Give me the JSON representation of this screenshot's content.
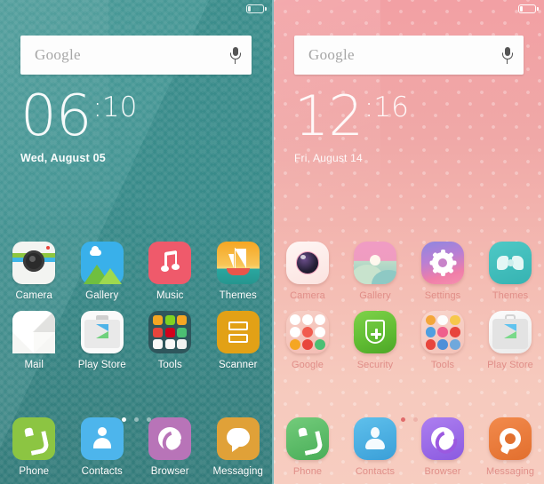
{
  "screens": [
    {
      "id": "teal-home",
      "theme_name": "teal-wave-theme",
      "accent": "#3d9290",
      "label_color": "#ffffff",
      "statusbar": {
        "battery_icon": "battery-icon"
      },
      "search": {
        "placeholder": "Google",
        "mic_icon": "microphone-icon"
      },
      "clock": {
        "hours": "06",
        "minutes": ":10",
        "date": "Wed, August 05"
      },
      "grid": [
        [
          {
            "label": "Camera",
            "icon": "camera-icon"
          },
          {
            "label": "Gallery",
            "icon": "gallery-icon"
          },
          {
            "label": "Music",
            "icon": "music-icon"
          },
          {
            "label": "Themes",
            "icon": "themes-sailboat-icon"
          }
        ],
        [
          {
            "label": "Mail",
            "icon": "mail-envelope-icon"
          },
          {
            "label": "Play Store",
            "icon": "play-store-icon"
          },
          {
            "label": "Tools",
            "icon": "tools-folder-icon"
          },
          {
            "label": "Scanner",
            "icon": "scanner-icon"
          }
        ]
      ],
      "page_dots": {
        "count": 3,
        "active": 0
      },
      "dock": [
        {
          "label": "Phone",
          "icon": "phone-icon"
        },
        {
          "label": "Contacts",
          "icon": "contacts-icon"
        },
        {
          "label": "Browser",
          "icon": "browser-icon"
        },
        {
          "label": "Messaging",
          "icon": "messaging-icon"
        }
      ]
    },
    {
      "id": "pink-home",
      "theme_name": "pink-polkadot-theme",
      "accent": "#f2a0a4",
      "label_color": "#e08e88",
      "statusbar": {
        "battery_icon": "battery-icon"
      },
      "search": {
        "placeholder": "Google",
        "mic_icon": "microphone-icon"
      },
      "clock": {
        "hours": "12",
        "minutes": ":16",
        "date": "Fri, August 14"
      },
      "grid": [
        [
          {
            "label": "Camera",
            "icon": "camera-icon"
          },
          {
            "label": "Gallery",
            "icon": "gallery-icon"
          },
          {
            "label": "Settings",
            "icon": "settings-gear-icon"
          },
          {
            "label": "Themes",
            "icon": "themes-bowtie-icon"
          }
        ],
        [
          {
            "label": "Google",
            "icon": "google-folder-icon"
          },
          {
            "label": "Security",
            "icon": "security-shield-icon"
          },
          {
            "label": "Tools",
            "icon": "tools-folder-icon"
          },
          {
            "label": "Play Store",
            "icon": "play-store-icon"
          }
        ]
      ],
      "page_dots": {
        "count": 2,
        "active": 0
      },
      "dock": [
        {
          "label": "Phone",
          "icon": "phone-icon"
        },
        {
          "label": "Contacts",
          "icon": "contacts-icon"
        },
        {
          "label": "Browser",
          "icon": "browser-icon"
        },
        {
          "label": "Messaging",
          "icon": "messaging-icon"
        }
      ]
    }
  ]
}
